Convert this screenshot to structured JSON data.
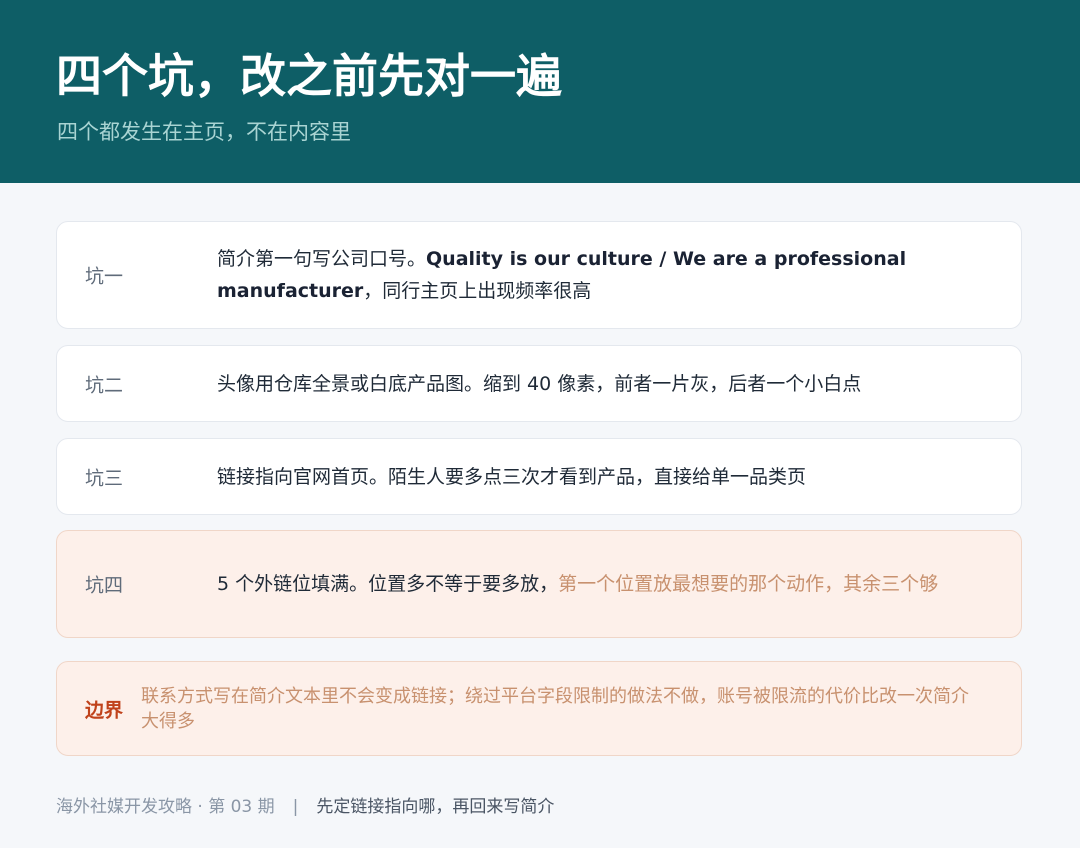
{
  "header": {
    "title": "四个坑，改之前先对一遍",
    "subtitle": "四个都发生在主页，不在内容里"
  },
  "pitfalls": [
    {
      "label": "坑一",
      "text_before": "简介第一句写公司口号。",
      "text_bold": "Quality is our culture / We are a professional manufacturer",
      "text_after": "，同行主页上出现频率很高"
    },
    {
      "label": "坑二",
      "text": "头像用仓库全景或白底产品图。缩到 40 像素，前者一片灰，后者一个小白点"
    },
    {
      "label": "坑三",
      "text": "链接指向官网首页。陌生人要多点三次才看到产品，直接给单一品类页"
    },
    {
      "label": "坑四",
      "text_before": "5 个外链位填满。位置多不等于要多放，",
      "text_accent": "第一个位置放最想要的那个动作，其余三个够"
    }
  ],
  "boundary": {
    "label": "边界",
    "text": "联系方式写在简介文本里不会变成链接；绕过平台字段限制的做法不做，账号被限流的代价比改一次简介大得多"
  },
  "footer": {
    "brand": "海外社媒开发攻略 · 第 03 期",
    "separator": "|",
    "note": "先定链接指向哪，再回来写简介"
  },
  "colors": {
    "header_bg": "#0e5e66",
    "page_bg": "#f5f7fa",
    "warn_bg": "#fdf0ea",
    "accent_text": "#c8916f",
    "boundary_label": "#c0421b"
  }
}
